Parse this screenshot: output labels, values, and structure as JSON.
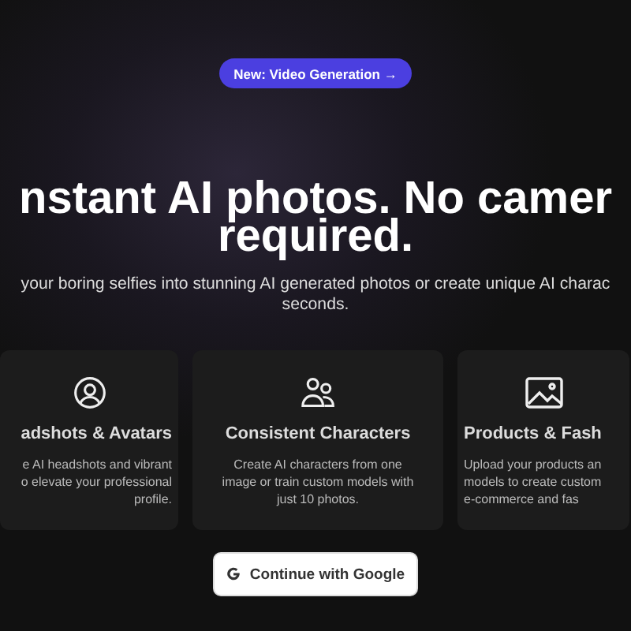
{
  "badge": {
    "label": "New: Video Generation →"
  },
  "headline": [
    "nstant AI photos. No camer",
    "required."
  ],
  "subtitle": [
    "your boring selfies into stunning AI generated photos or create unique AI charac",
    "seconds."
  ],
  "cards": [
    {
      "kind": "person",
      "title": "adshots & Avatars",
      "description": "e AI headshots and vibrant\no elevate your professional\nprofile."
    },
    {
      "kind": "people",
      "title": "Consistent Characters",
      "description": "Create AI characters from one\nimage or train custom models with\njust 10 photos."
    },
    {
      "kind": "image",
      "title": "Products & Fash",
      "description": "Upload your products an\nmodels to create custom\ne-commerce and fas"
    }
  ],
  "google_button": {
    "label": "Continue with Google"
  }
}
